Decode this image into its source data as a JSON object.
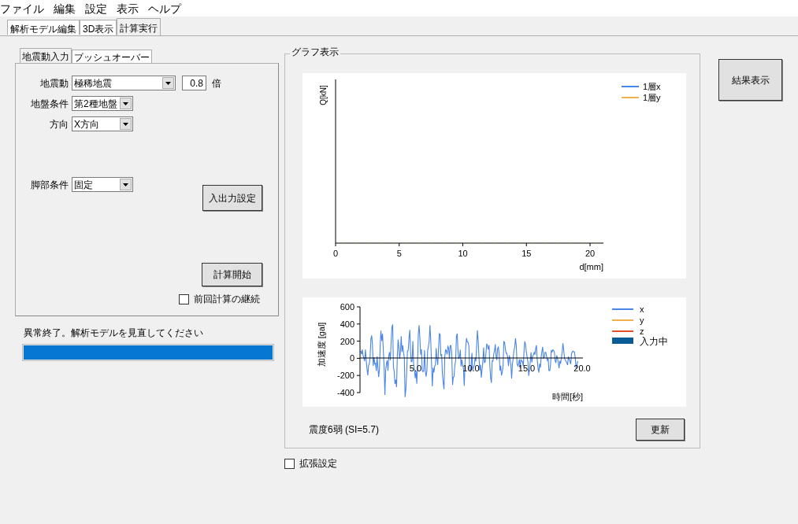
{
  "menu": [
    "ファイル",
    "編集",
    "設定",
    "表示",
    "ヘルプ"
  ],
  "tabs": [
    {
      "label": "解析モデル編集",
      "selected": false
    },
    {
      "label": "3D表示",
      "selected": false
    },
    {
      "label": "計算実行",
      "selected": true
    }
  ],
  "input_tabs": [
    {
      "label": "地震動入力",
      "selected": true
    },
    {
      "label": "プッシュオーバー",
      "selected": false
    }
  ],
  "rows": [
    {
      "label": "地震動",
      "value": "極稀地震",
      "factor": "0.8",
      "unit": "倍"
    },
    {
      "label": "地盤条件",
      "value": "第2種地盤"
    },
    {
      "label": "方向",
      "value": "X方向"
    }
  ],
  "foot_condition": {
    "label": "脚部条件",
    "value": "固定"
  },
  "io_settings_button": "入出力設定",
  "start_button": "計算開始",
  "continue_checkbox": {
    "label": "前回計算の継続",
    "checked": false
  },
  "status": {
    "message": "異常終了。解析モデルを見直してください",
    "level": 1
  },
  "graph": {
    "title": "グラフ表示",
    "chart1": {
      "ylabel": "Q[kN]",
      "xlabel": "d[mm]",
      "xticks": [
        "0",
        "5",
        "10",
        "15",
        "20"
      ],
      "legend": [
        {
          "label": "1層x",
          "color": "#4a86e8"
        },
        {
          "label": "1層y",
          "color": "#f0b050"
        }
      ]
    },
    "chart2": {
      "ylabel": "加速度 [gal]",
      "xlabel": "時間[秒]",
      "yticks": [
        "600",
        "400",
        "200",
        "0",
        "-200",
        "-400"
      ],
      "xticks": [
        "5.0",
        "10.0",
        "15.0",
        "20.0"
      ],
      "legend": [
        {
          "label": "x",
          "color": "#4a86e8",
          "kind": "line"
        },
        {
          "label": "y",
          "color": "#f0b050",
          "kind": "line"
        },
        {
          "label": "z",
          "color": "#e0502a",
          "kind": "line"
        },
        {
          "label": "入力中",
          "color": "#0a5c96",
          "kind": "swatch"
        }
      ]
    },
    "intensity": "震度6弱 (SI=5.7)",
    "update_button": "更新"
  },
  "extended_checkbox": {
    "label": "拡張設定",
    "checked": false
  },
  "result_button": "結果表示"
}
